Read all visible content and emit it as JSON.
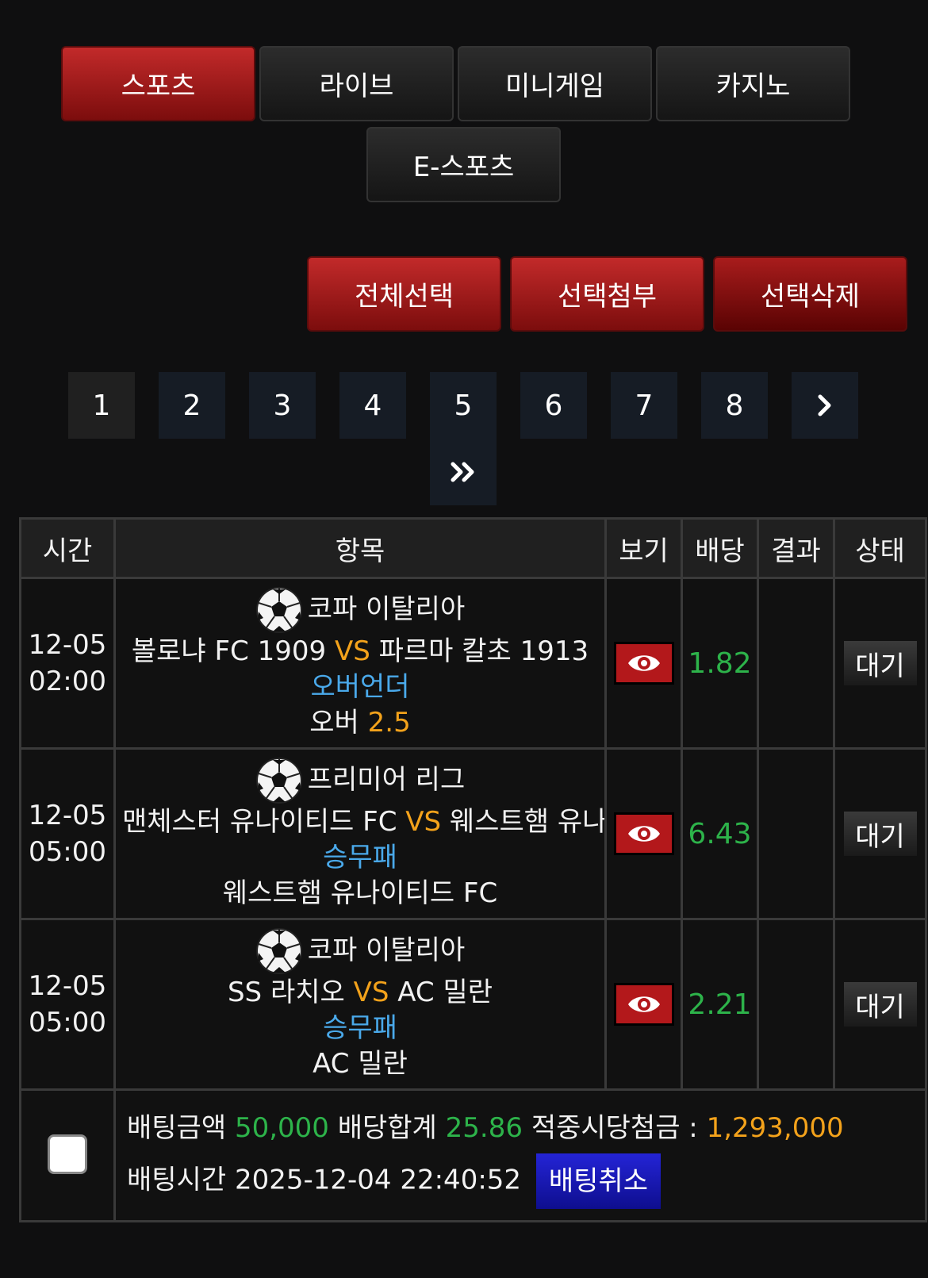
{
  "tabs": [
    {
      "label": "스포츠",
      "active": true
    },
    {
      "label": "라이브",
      "active": false
    },
    {
      "label": "미니게임",
      "active": false
    },
    {
      "label": "카지노",
      "active": false
    },
    {
      "label": "E-스포츠",
      "active": false
    }
  ],
  "actions": {
    "select_all": "전체선택",
    "attach_selected": "선택첨부",
    "delete_selected": "선택삭제"
  },
  "pagination": {
    "pages": [
      "1",
      "2",
      "3",
      "4",
      "5",
      "6",
      "7",
      "8"
    ],
    "current": "1",
    "next_icon": "chevron-right-icon",
    "last_icon": "double-chevron-right-icon"
  },
  "table": {
    "headers": {
      "time": "시간",
      "item": "항목",
      "view": "보기",
      "odds": "배당",
      "result": "결과",
      "status": "상태"
    },
    "rows": [
      {
        "date": "12-05",
        "time": "02:00",
        "league": "코파 이탈리아",
        "home": "볼로냐 FC 1909",
        "vs": "VS",
        "away": "파르마 칼초 1913",
        "market": "오버언더",
        "pick_label": "오버",
        "pick_value": "2.5",
        "odds": "1.82",
        "result": "",
        "status": "대기"
      },
      {
        "date": "12-05",
        "time": "05:00",
        "league": "프리미어 리그",
        "home": "맨체스터 유나이티드 FC",
        "vs": "VS",
        "away": "웨스트햄 유나이티드 FC",
        "market": "승무패",
        "pick_label": "웨스트햄 유나이티드 FC",
        "pick_value": "",
        "odds": "6.43",
        "result": "",
        "status": "대기"
      },
      {
        "date": "12-05",
        "time": "05:00",
        "league": "코파 이탈리아",
        "home": "SS 라치오",
        "vs": "VS",
        "away": "AC 밀란",
        "market": "승무패",
        "pick_label": "AC 밀란",
        "pick_value": "",
        "odds": "2.21",
        "result": "",
        "status": "대기"
      }
    ]
  },
  "summary": {
    "bet_amount_label": "배팅금액",
    "bet_amount": "50,000",
    "total_odds_label": "배당합계",
    "total_odds": "25.86",
    "payout_label": "적중시당첨금 :",
    "payout": "1,293,000",
    "bet_time_label": "배팅시간",
    "bet_time": "2025-12-04 22:40:52",
    "cancel_label": "배팅취소"
  },
  "colors": {
    "accent_red": "#b3181b",
    "odds_green": "#2db34a",
    "vs_orange": "#f3a21b",
    "market_blue": "#4aa9ea",
    "cancel_blue": "#1c1cc4"
  }
}
